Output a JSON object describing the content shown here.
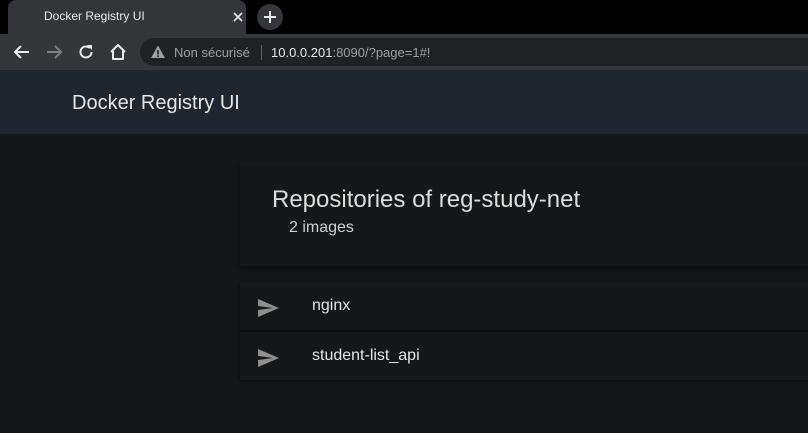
{
  "browser": {
    "tab": {
      "title": "Docker Registry UI",
      "close_icon": "close-icon"
    },
    "new_tab_icon": "plus-icon",
    "nav": {
      "back_icon": "back-arrow-icon",
      "forward_icon": "forward-arrow-icon",
      "reload_icon": "reload-icon",
      "home_icon": "home-icon"
    },
    "address_bar": {
      "security_icon": "warning-triangle-icon",
      "security_text": "Non sécurisé",
      "url_host": "10.0.0.201",
      "url_rest": ":8090/?page=1#!"
    }
  },
  "app": {
    "title": "Docker Registry UI"
  },
  "main": {
    "heading": "Repositories of reg-study-net",
    "image_count": "2 images",
    "repositories": [
      {
        "name": "nginx",
        "icon": "send-icon"
      },
      {
        "name": "student-list_api",
        "icon": "send-icon"
      }
    ]
  },
  "colors": {
    "app_bar": "#1e2730",
    "page_background": "#141517",
    "card_background": "#161718",
    "icon": "#8f8f8f"
  }
}
